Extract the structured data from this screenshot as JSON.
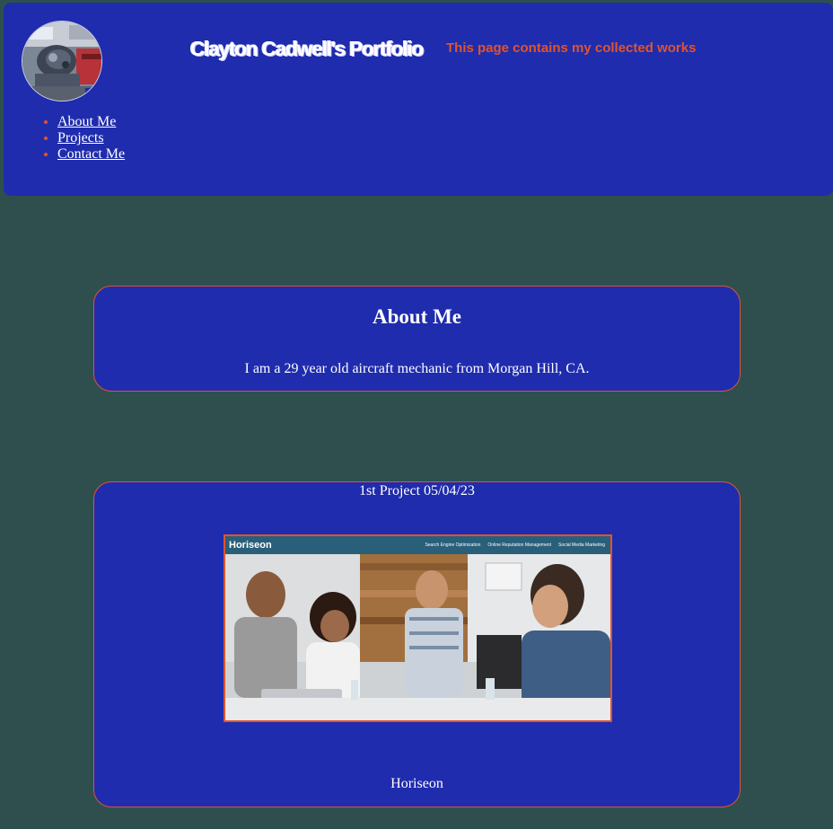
{
  "header": {
    "title": "Clayton Cadwell's Portfolio",
    "tagline": "This page contains my collected works",
    "nav": [
      {
        "label": "About Me"
      },
      {
        "label": "Projects"
      },
      {
        "label": "Contact Me"
      }
    ]
  },
  "about": {
    "heading": "About Me",
    "text": "I am a 29 year old aircraft mechanic from Morgan Hill, CA."
  },
  "projects": [
    {
      "date_label": "1st Project 05/04/23",
      "name": "Horiseon",
      "screenshot": {
        "brand": "Horiseon",
        "links": [
          "Search Engine Optimization",
          "Online Reputation Management",
          "Social Media Marketing"
        ]
      }
    }
  ],
  "colors": {
    "page_background": "#2f4f4f",
    "panel": "#1f2cad",
    "accent": "#e0542e",
    "text": "#ffffff"
  }
}
